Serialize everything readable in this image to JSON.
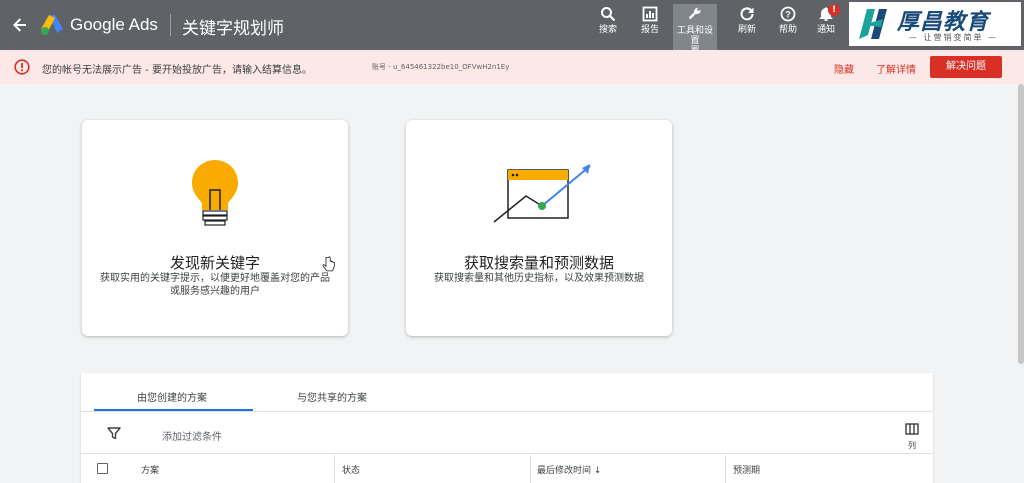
{
  "header": {
    "ads_name": "Google Ads",
    "page_title": "关键字规划师",
    "tools": [
      {
        "label": "搜索",
        "icon": "search-icon"
      },
      {
        "label": "报告",
        "icon": "reports-icon"
      },
      {
        "label": "工具和设置",
        "label_line2": "置",
        "icon": "wrench-icon"
      },
      {
        "label": "刷新",
        "icon": "refresh-icon"
      },
      {
        "label": "帮助",
        "icon": "help-icon"
      },
      {
        "label": "通知",
        "icon": "bell-icon",
        "badge": "!"
      }
    ],
    "brand": {
      "title": "厚昌教育",
      "subtitle": "— 让营销变简单 —"
    }
  },
  "alert": {
    "message": "您的帐号无法展示广告 - 要开始投放广告，请输入结算信息。",
    "account_id": "账号 - u_645461322be10_OFVwH2n1Ey",
    "dismiss_label": "隐藏",
    "learn_more_label": "了解详情",
    "fix_label": "解决问题"
  },
  "cards": [
    {
      "title": "发现新关键字",
      "desc": "获取实用的关键字提示，以便更好地覆盖对您的产品或服务感兴趣的用户",
      "icon": "lightbulb-icon"
    },
    {
      "title": "获取搜索量和预测数据",
      "desc": "获取搜索量和其他历史指标，以及效果预测数据",
      "icon": "forecast-chart-icon"
    }
  ],
  "plans": {
    "tabs": [
      {
        "label": "由您创建的方案",
        "selected": true
      },
      {
        "label": "与您共享的方案",
        "selected": false
      }
    ],
    "filter_label": "添加过滤条件",
    "columns_label": "列",
    "columns": [
      "方案",
      "状态",
      "最后修改时间",
      "预测期"
    ],
    "sort_indicator": "↓"
  },
  "colors": {
    "topbar": "#5f6368",
    "alert_bg": "#fce8e6",
    "alert_red": "#d93025",
    "tab_blue": "#1a73e8",
    "bulb_yellow": "#f9ab00"
  }
}
